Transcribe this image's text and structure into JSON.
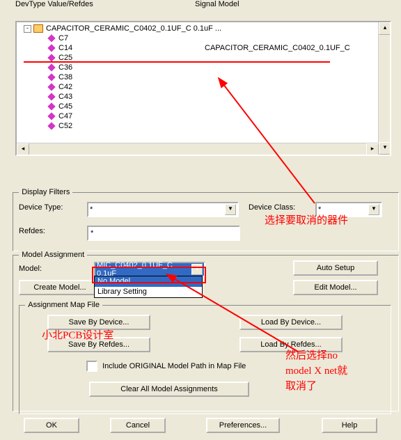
{
  "headers": {
    "c1": "DevType Value/Refdes",
    "c2": "Signal Model"
  },
  "tree": {
    "root": "CAPACITOR_CERAMIC_C0402_0.1UF_C 0.1uF ...",
    "items": [
      "C7",
      "C14",
      "C25",
      "C36",
      "C38",
      "C42",
      "C43",
      "C45",
      "C47",
      "C52"
    ],
    "signal_model_c14": "CAPACITOR_CERAMIC_C0402_0.1UF_C"
  },
  "filters": {
    "legend": "Display Filters",
    "devtype_lbl": "Device Type:",
    "devtype_val": "*",
    "devclass_lbl": "Device Class:",
    "devclass_val": "*",
    "refdes_lbl": "Refdes:",
    "refdes_val": "*"
  },
  "assign": {
    "legend": "Model Assignment",
    "model_lbl": "Model:",
    "model_val": "MIC_C0402_0.1UF_C 0.1uF",
    "dd_opt1": "No Model",
    "dd_opt2": "Library Setting",
    "create": "Create Model...",
    "auto": "Auto Setup",
    "edit": "Edit Model..."
  },
  "map": {
    "legend": "Assignment Map File",
    "save_dev": "Save By Device...",
    "load_dev": "Load By Device...",
    "save_ref": "Save By Refdes...",
    "load_ref": "Load By Refdes...",
    "chk": "Include ORIGINAL Model Path in Map File",
    "clear": "Clear All Model Assignments"
  },
  "btm": {
    "ok": "OK",
    "cancel": "Cancel",
    "pref": "Preferences...",
    "help": "Help"
  },
  "ann": {
    "a1": "选择要取消的器件",
    "a2": "小北PCB设计室",
    "a3a": "然后选择no",
    "a3b": "model  X net就",
    "a3c": "取消了"
  }
}
